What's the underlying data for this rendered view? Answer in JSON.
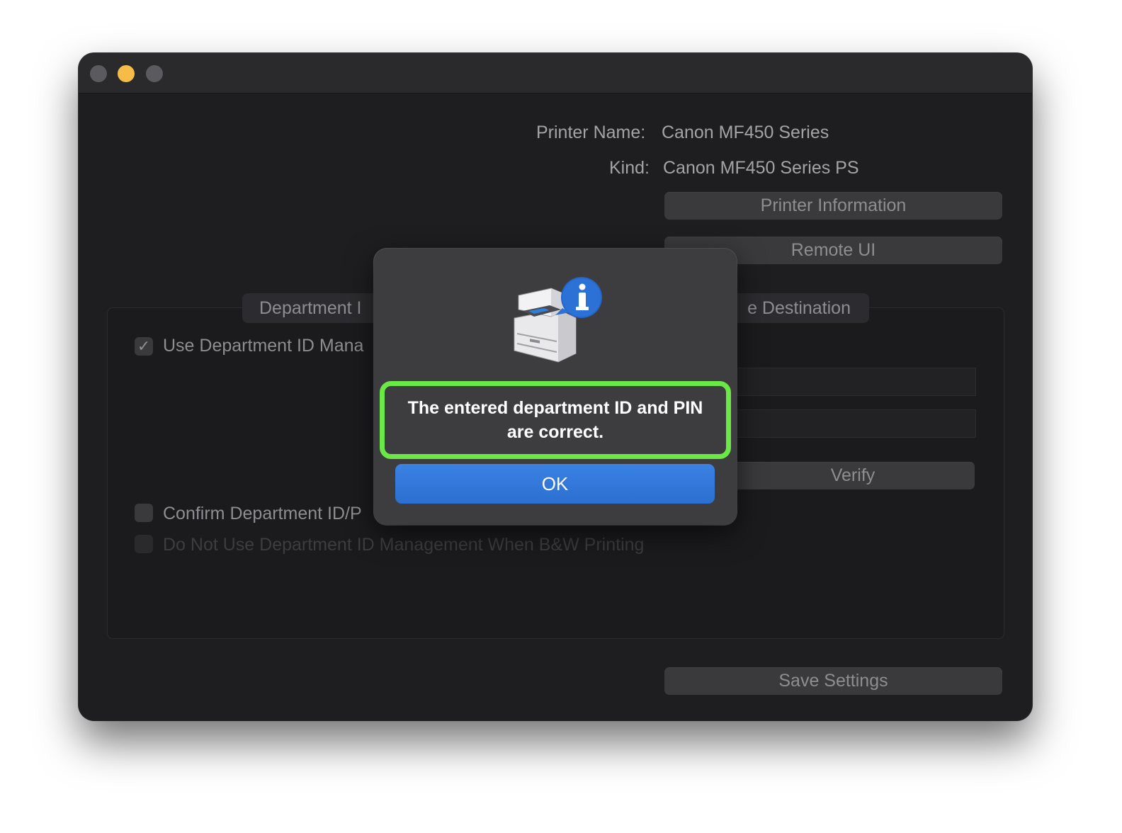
{
  "window": {
    "traffic_lights": [
      "close",
      "minimize",
      "zoom"
    ]
  },
  "printer": {
    "name_label": "Printer Name:",
    "name_value": "Canon MF450 Series",
    "kind_label": "Kind:",
    "kind_value": "Canon MF450 Series PS"
  },
  "buttons": {
    "printer_information": "Printer Information",
    "remote_ui": "Remote UI",
    "verify": "Verify",
    "save_settings": "Save Settings"
  },
  "tabs": {
    "left_label": "Department I",
    "right_label": "e Destination"
  },
  "options": {
    "use_dept_id": "Use Department ID Mana",
    "confirm_dept_id": "Confirm Department ID/P",
    "do_not_use_bw": "Do Not Use Department ID Management When B&W Printing",
    "use_dept_id_checked": "✓"
  },
  "dialog": {
    "message": "The entered department ID and PIN are correct.",
    "ok_label": "OK",
    "icon": "printer-info-icon",
    "highlight_color": "#6ae845"
  },
  "colors": {
    "accent_blue": "#2c6fd1",
    "window_bg": "#1e1e21"
  }
}
